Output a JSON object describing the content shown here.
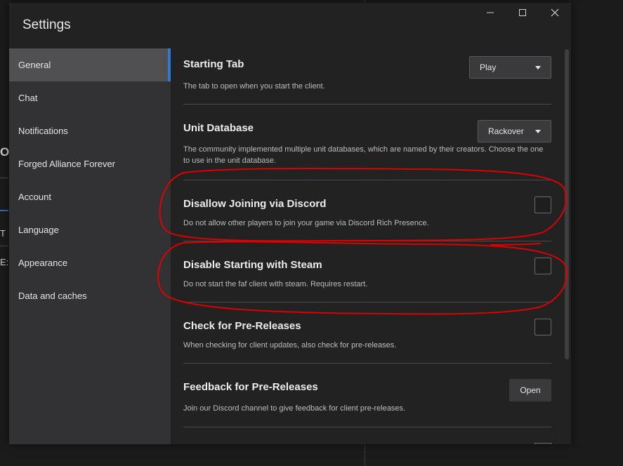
{
  "window": {
    "title": "Settings"
  },
  "background_fragments": [
    "OY",
    "T",
    "E:"
  ],
  "sidebar": {
    "items": [
      {
        "label": "General",
        "active": true
      },
      {
        "label": "Chat"
      },
      {
        "label": "Notifications"
      },
      {
        "label": "Forged Alliance Forever"
      },
      {
        "label": "Account"
      },
      {
        "label": "Language"
      },
      {
        "label": "Appearance"
      },
      {
        "label": "Data and caches"
      }
    ]
  },
  "settings": {
    "starting_tab": {
      "title": "Starting Tab",
      "desc": "The tab to open when you start the client.",
      "value": "Play"
    },
    "unit_database": {
      "title": "Unit Database",
      "desc": "The community implemented multiple unit databases, which are named by their creators. Choose the one to use in the unit database.",
      "value": "Rackover"
    },
    "disallow_discord": {
      "title": "Disallow Joining via Discord",
      "desc": "Do not allow other players to join your game via Discord Rich Presence.",
      "checked": false
    },
    "disable_steam": {
      "title": "Disable Starting with Steam",
      "desc": "Do not start the faf client with steam. Requires restart.",
      "checked": false
    },
    "pre_releases": {
      "title": "Check for Pre-Releases",
      "desc": "When checking for client updates, also check for pre-releases.",
      "checked": false
    },
    "feedback": {
      "title": "Feedback for Pre-Releases",
      "desc": "Join our Discord channel to give feedback for client pre-releases.",
      "button": "Open"
    }
  },
  "icons": {
    "minimize": "minimize-icon",
    "maximize": "maximize-icon",
    "close": "close-icon",
    "dropdown": "chevron-down-icon"
  },
  "colors": {
    "accent": "#2f78d6",
    "annotation": "#e00000"
  }
}
